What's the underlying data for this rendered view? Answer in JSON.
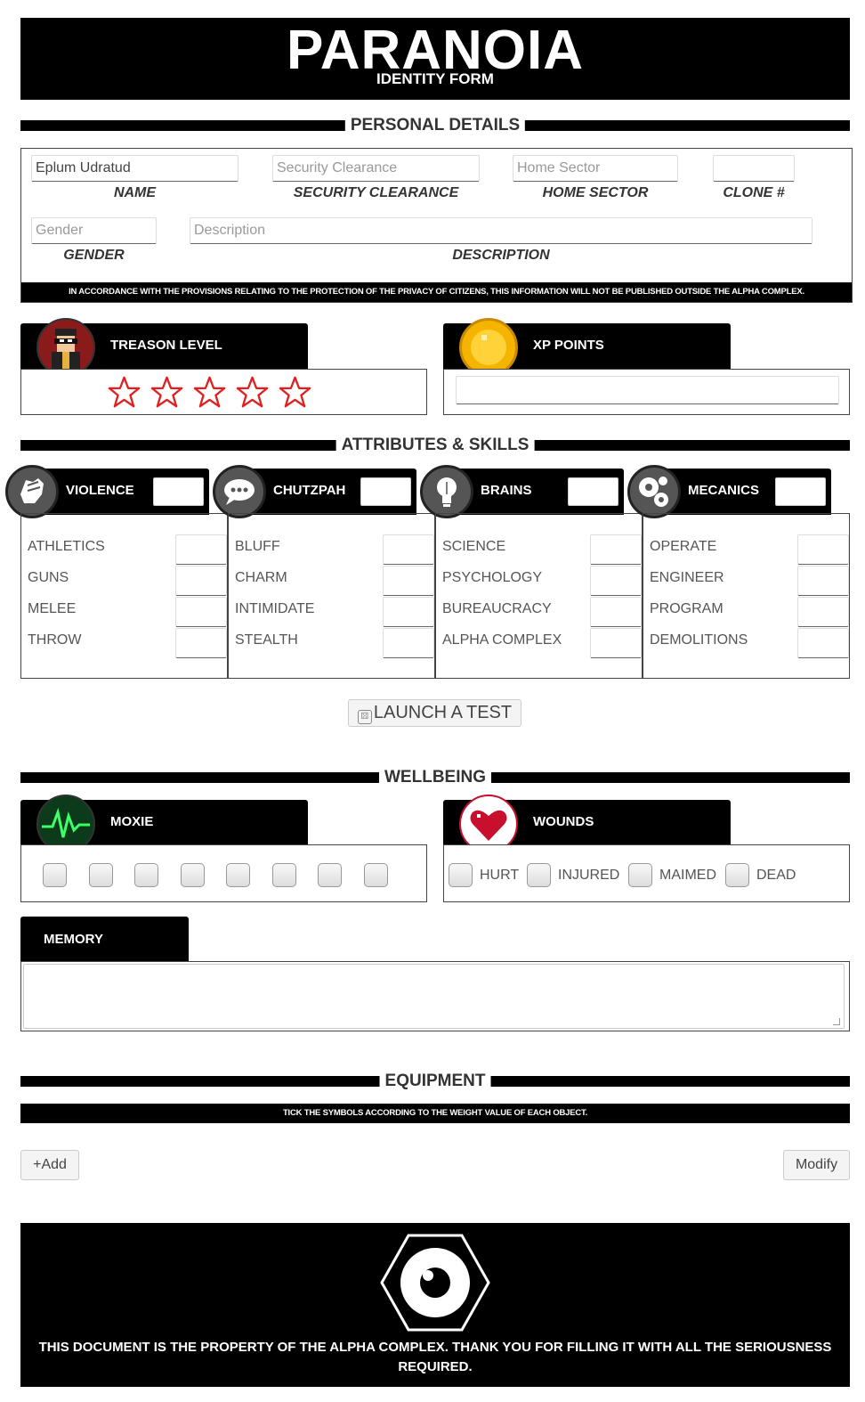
{
  "header": {
    "title": "PARANOIA",
    "subtitle": "IDENTITY FORM"
  },
  "sections": {
    "personal": "PERSONAL DETAILS",
    "attributes": "ATTRIBUTES & SKILLS",
    "wellbeing": "WELLBEING",
    "equipment": "EQUIPMENT"
  },
  "personal": {
    "name_value": "Eplum Udratud",
    "security_placeholder": "Security Clearance",
    "home_sector_placeholder": "Home Sector",
    "clone_value": "",
    "gender_placeholder": "Gender",
    "description_placeholder": "Description",
    "labels": {
      "name": "NAME",
      "security": "SECURITY CLEARANCE",
      "home_sector": "HOME SECTOR",
      "clone": "CLONE #",
      "gender": "GENDER",
      "description": "DESCRIPTION"
    },
    "notice": "IN ACCORDANCE WITH THE PROVISIONS RELATING TO THE PROTECTION OF THE PRIVACY OF CITIZENS, THIS INFORMATION WILL NOT BE PUBLISHED OUTSIDE THE ALPHA COMPLEX."
  },
  "treason": {
    "label": "TREASON LEVEL",
    "stars_total": 5,
    "stars_filled": 0,
    "star_color": "#e02020"
  },
  "xp": {
    "label": "XP POINTS",
    "value": ""
  },
  "attributes": [
    {
      "name": "VIOLENCE",
      "icon": "fist-icon",
      "skills": [
        "ATHLETICS",
        "GUNS",
        "MELEE",
        "THROW"
      ]
    },
    {
      "name": "CHUTZPAH",
      "icon": "speech-bubble-icon",
      "skills": [
        "BLUFF",
        "CHARM",
        "INTIMIDATE",
        "STEALTH"
      ]
    },
    {
      "name": "BRAINS",
      "icon": "lightbulb-icon",
      "skills": [
        "SCIENCE",
        "PSYCHOLOGY",
        "BUREAUCRACY",
        "ALPHA COMPLEX"
      ]
    },
    {
      "name": "MECANICS",
      "icon": "gears-icon",
      "skills": [
        "OPERATE",
        "ENGINEER",
        "PROGRAM",
        "DEMOLITIONS"
      ]
    }
  ],
  "launch_button": "LAUNCH A TEST",
  "moxie": {
    "label": "MOXIE",
    "boxes": 8
  },
  "wounds": {
    "label": "WOUNDS",
    "levels": [
      "HURT",
      "INJURED",
      "MAIMED",
      "DEAD"
    ]
  },
  "memory": {
    "label": "MEMORY",
    "value": ""
  },
  "equipment": {
    "notice": "TICK THE SYMBOLS ACCORDING TO THE WEIGHT VALUE OF EACH OBJECT.",
    "add_label": "+Add",
    "modify_label": "Modify"
  },
  "footer": {
    "text": "THIS DOCUMENT IS THE PROPERTY OF THE ALPHA COMPLEX. THANK YOU FOR FILLING IT WITH ALL THE SERIOUSNESS REQUIRED."
  },
  "colors": {
    "accent": "#000000",
    "star": "#e02020",
    "heart": "#c8102e",
    "moxie_bg": "#0b3b1a",
    "xp_coin": "#f5b400"
  }
}
